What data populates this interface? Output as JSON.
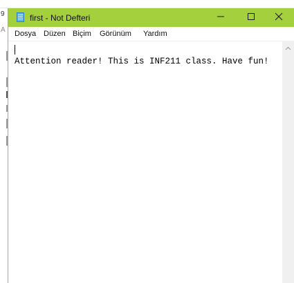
{
  "window": {
    "title": "first - Not Defteri",
    "accent_color": "#a4d03e",
    "icon": "notepad-icon"
  },
  "controls": {
    "minimize_icon": "minimize-icon",
    "maximize_icon": "maximize-icon",
    "close_icon": "close-icon"
  },
  "menu": {
    "items": [
      {
        "label": "Dosya"
      },
      {
        "label": "Düzen"
      },
      {
        "label": "Biçim"
      },
      {
        "label": "Görünüm"
      },
      {
        "label": "Yardım"
      }
    ]
  },
  "editor": {
    "content": "Attention reader! This is INF211 class. Have fun!"
  },
  "background": {
    "fragments": [
      "9",
      "A"
    ]
  },
  "scrollbar": {
    "up_icon": "chevron-up-icon"
  }
}
